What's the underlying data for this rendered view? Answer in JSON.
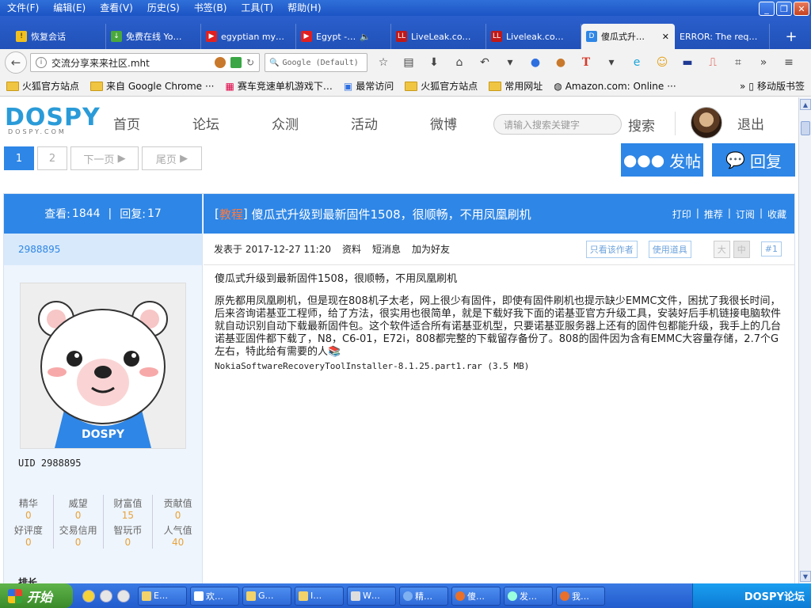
{
  "menu": [
    "文件(F)",
    "编辑(E)",
    "查看(V)",
    "历史(S)",
    "书签(B)",
    "工具(T)",
    "帮助(H)"
  ],
  "tabs": [
    {
      "label": "恢复会话",
      "icon_color": "#f0c020",
      "icon": "warning-icon"
    },
    {
      "label": "免费在线 Yo…",
      "icon_color": "#4aa83c",
      "icon": "download-icon"
    },
    {
      "label": "egyptian my…",
      "icon_color": "#e02020",
      "icon": "youtube-icon"
    },
    {
      "label": "Egypt -…",
      "icon_color": "#e02020",
      "icon": "youtube-icon"
    },
    {
      "label": "LiveLeak.co…",
      "icon_color": "#c01818",
      "icon": "liveleak-icon"
    },
    {
      "label": "Liveleak.co…",
      "icon_color": "#c01818",
      "icon": "liveleak-icon"
    },
    {
      "label": "傻瓜式升…",
      "icon_color": "#2e86e6",
      "icon": "dospy-icon",
      "active": true
    },
    {
      "label": "ERROR: The req…",
      "icon_color": "#999999",
      "icon": "blank-icon"
    }
  ],
  "address": {
    "url": "交流分享来来社区.mht",
    "search_placeholder": "Google (Default)"
  },
  "bookmarks": [
    "火狐官方站点",
    "来自 Google Chrome",
    "赛车竞速单机游戏下…",
    "最常访问",
    "火狐官方站点",
    "常用网址",
    "Amazon.com: Online",
    "移动版书签"
  ],
  "site": {
    "logo": "DOSPY",
    "logo_sub": "DOSPY.COM",
    "nav": [
      "首页",
      "论坛",
      "众测",
      "活动",
      "微博"
    ],
    "search_placeholder": "请输入搜索关键字",
    "search_label": "搜索",
    "logout": "退出"
  },
  "pager": {
    "pages": [
      "1",
      "2"
    ],
    "next": "下一页",
    "last": "尾页"
  },
  "buttons": {
    "post": "发帖",
    "reply": "回复"
  },
  "thread": {
    "views_label": "查看:",
    "views": "1844",
    "sep": "|",
    "replies_label": "回复:",
    "replies": "17",
    "tag": "教程",
    "title": "傻瓜式升级到最新固件1508，很顺畅，不用凤凰刷机",
    "actions": [
      "打印",
      "推荐",
      "订阅",
      "收藏"
    ]
  },
  "author": {
    "name": "2988895",
    "uid_label": "UID",
    "uid": "2988895",
    "stats": [
      {
        "k": "精华",
        "v": "0"
      },
      {
        "k": "威望",
        "v": "0"
      },
      {
        "k": "财富值",
        "v": "15"
      },
      {
        "k": "贡献值",
        "v": "0"
      },
      {
        "k": "好评度",
        "v": "0"
      },
      {
        "k": "交易信用",
        "v": "0"
      },
      {
        "k": "智玩币",
        "v": "0"
      },
      {
        "k": "人气值",
        "v": "40"
      }
    ],
    "rank": "排长"
  },
  "post": {
    "posted_label": "发表于",
    "posted": "2017-12-27 11:20",
    "meta_links": [
      "资料",
      "短消息",
      "加为好友"
    ],
    "chips": [
      "只看该作者",
      "使用道具"
    ],
    "size_small": "大",
    "size_mid": "中",
    "floor": "#1",
    "headline": "傻瓜式升级到最新固件1508，很顺畅，不用凤凰刷机",
    "body": "原先都用凤凰刷机，但是现在808机子太老，网上很少有固件，即使有固件刷机也提示缺少EMMC文件，困扰了我很长时间，后来咨询诺基亚工程师，给了方法，很实用也很简单，就是下载好我下面的诺基亚官方升级工具，安装好后手机链接电脑软件就自动识别自动下载最新固件包。这个软件适合所有诺基亚机型，只要诺基亚服务器上还有的固件包都能升级，我手上的几台诺基亚固件都下载了，N8，C6-01，E72i，808都完整的下载留存备份了。808的固件因为含有EMMC大容量存储，2.7个G左右，特此给有需要的人",
    "attachment": "NokiaSoftwareRecoveryToolInstaller-8.1.25.part1.rar (3.5 MB)"
  },
  "taskbar": {
    "start": "开始",
    "tasks": [
      "E…",
      "欢…",
      "G…",
      "I…",
      "W…",
      "精…",
      "傻…",
      "发…",
      "我…"
    ],
    "tray_text": "DOSPY论坛"
  }
}
